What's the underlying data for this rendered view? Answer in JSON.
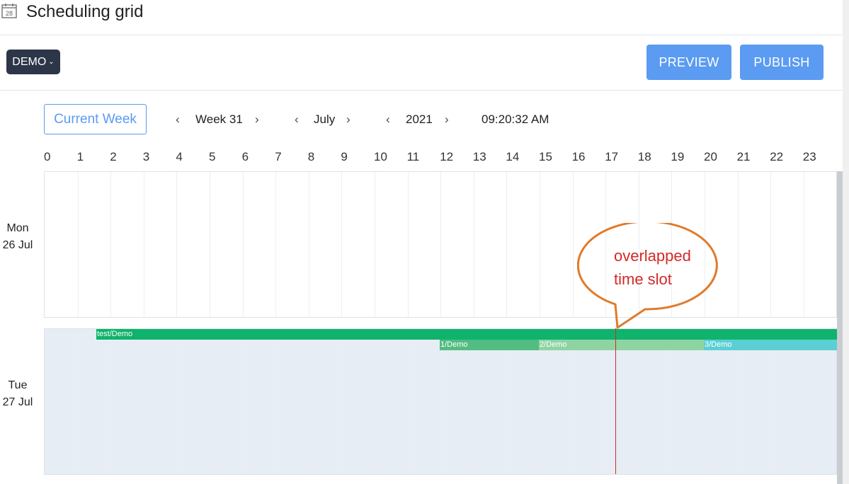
{
  "header": {
    "title": "Scheduling grid",
    "calendar_icon_text": "28"
  },
  "toolbar": {
    "demo_label": "DEMO",
    "preview_label": "PREVIEW",
    "publish_label": "PUBLISH"
  },
  "nav": {
    "current_week_label": "Current Week",
    "week_label": "Week 31",
    "month_label": "July",
    "year_label": "2021",
    "time_label": "09:20:32 AM"
  },
  "hours": [
    "0",
    "1",
    "2",
    "3",
    "4",
    "5",
    "6",
    "7",
    "8",
    "9",
    "10",
    "11",
    "12",
    "13",
    "14",
    "15",
    "16",
    "17",
    "18",
    "19",
    "20",
    "21",
    "22",
    "23"
  ],
  "days": [
    {
      "weekday": "Mon",
      "date": "26 Jul"
    },
    {
      "weekday": "Tue",
      "date": "27 Jul"
    }
  ],
  "shifts": [
    {
      "label": "test/Demo",
      "color": "#0fb36b"
    },
    {
      "label": "1/Demo",
      "color": "#52bd82"
    },
    {
      "label": "2/Demo",
      "color": "#8ed4a3"
    },
    {
      "label": "3/Demo",
      "color": "#5ccfd4"
    }
  ],
  "annotation": {
    "line1": "overlapped",
    "line2": "time slot"
  },
  "colors": {
    "accent": "#5b9bf2",
    "dark_button": "#2d3648",
    "now_line": "#d42b2b",
    "callout_stroke": "#e07a2a",
    "callout_text": "#d62828"
  }
}
